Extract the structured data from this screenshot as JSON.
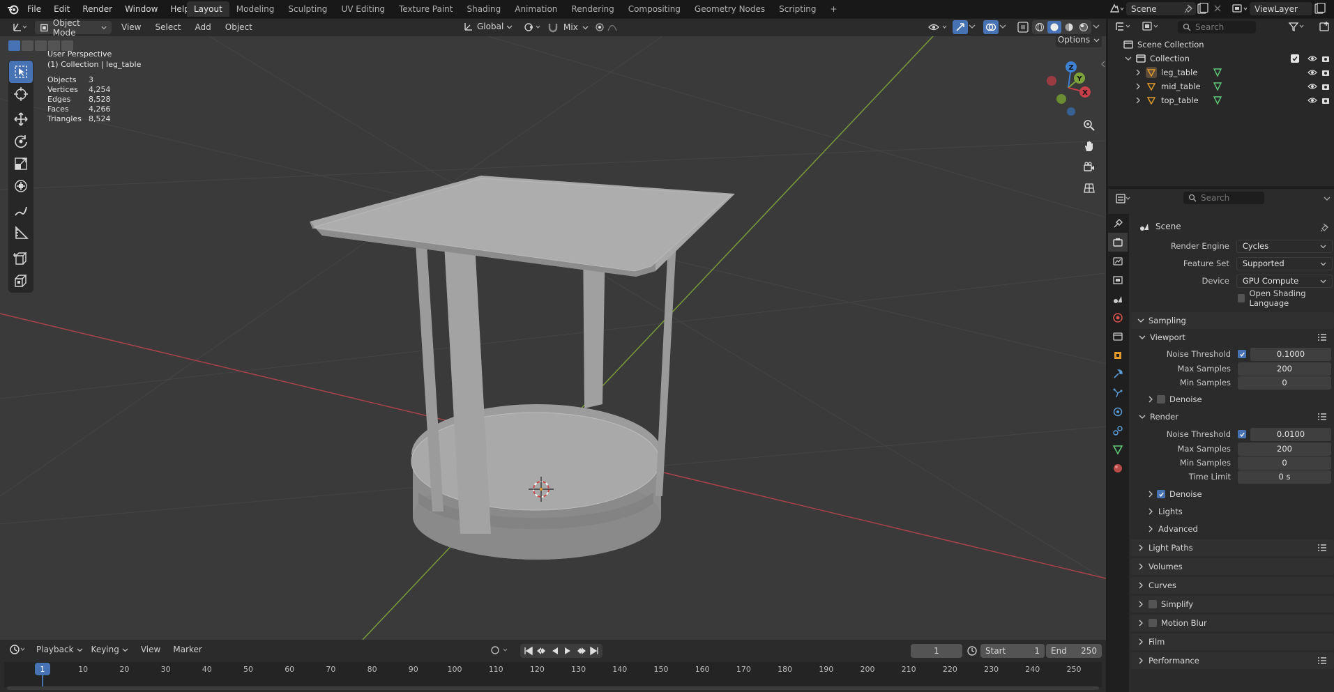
{
  "topbar": {
    "menus": [
      "File",
      "Edit",
      "Render",
      "Window",
      "Help"
    ],
    "workspaces": [
      "Layout",
      "Modeling",
      "Sculpting",
      "UV Editing",
      "Texture Paint",
      "Shading",
      "Animation",
      "Rendering",
      "Compositing",
      "Geometry Nodes",
      "Scripting"
    ],
    "active_workspace": "Layout",
    "add_workspace": "+",
    "scene_name": "Scene",
    "view_layer": "ViewLayer"
  },
  "viewport_header": {
    "mode": "Object Mode",
    "menus": [
      "View",
      "Select",
      "Add",
      "Object"
    ],
    "orientation": "Global",
    "snap_mix": "Mix",
    "options_label": "Options"
  },
  "viewport": {
    "view_name": "User Perspective",
    "collection_info": "(1) Collection | leg_table",
    "stats": [
      {
        "label": "Objects",
        "value": "3"
      },
      {
        "label": "Vertices",
        "value": "4,254"
      },
      {
        "label": "Edges",
        "value": "8,528"
      },
      {
        "label": "Faces",
        "value": "4,266"
      },
      {
        "label": "Triangles",
        "value": "8,524"
      }
    ],
    "gizmo_axes": [
      "Z",
      "Y",
      "X"
    ],
    "colors": {
      "x_axis": "#c4404a",
      "y_axis": "#7da33a",
      "z_axis": "#3e81d4",
      "mesh": "#a9a9a9",
      "active_tool": "#4772b3"
    }
  },
  "timeline": {
    "menus": [
      "Playback",
      "Keying",
      "View",
      "Marker"
    ],
    "current_frame": "1",
    "start_label": "Start",
    "start_value": "1",
    "end_label": "End",
    "end_value": "250",
    "ruler_ticks": [
      "10",
      "20",
      "30",
      "40",
      "50",
      "60",
      "70",
      "80",
      "90",
      "100",
      "110",
      "120",
      "130",
      "140",
      "150",
      "160",
      "170",
      "180",
      "190",
      "200",
      "210",
      "220",
      "230",
      "240",
      "250"
    ],
    "playhead_label": "1"
  },
  "outliner": {
    "search_placeholder": "Search",
    "scene_collection": "Scene Collection",
    "collection": "Collection",
    "objects": [
      "leg_table",
      "mid_table",
      "top_table"
    ]
  },
  "properties": {
    "search_placeholder": "Search",
    "context": "Scene",
    "render_engine_label": "Render Engine",
    "render_engine": "Cycles",
    "feature_set_label": "Feature Set",
    "feature_set": "Supported",
    "device_label": "Device",
    "device": "GPU Compute",
    "osl_label": "Open Shading Language",
    "sampling": "Sampling",
    "viewport_sub": "Viewport",
    "vp_noise_label": "Noise Threshold",
    "vp_noise": "0.1000",
    "vp_max_label": "Max Samples",
    "vp_max": "200",
    "vp_min_label": "Min Samples",
    "vp_min": "0",
    "vp_denoise": "Denoise",
    "render_sub": "Render",
    "r_noise_label": "Noise Threshold",
    "r_noise": "0.0100",
    "r_max_label": "Max Samples",
    "r_max": "200",
    "r_min_label": "Min Samples",
    "r_min": "0",
    "r_time_label": "Time Limit",
    "r_time": "0 s",
    "r_denoise": "Denoise",
    "lights": "Lights",
    "advanced": "Advanced",
    "panels": [
      "Light Paths",
      "Volumes",
      "Curves",
      "Simplify",
      "Motion Blur",
      "Film",
      "Performance"
    ]
  }
}
